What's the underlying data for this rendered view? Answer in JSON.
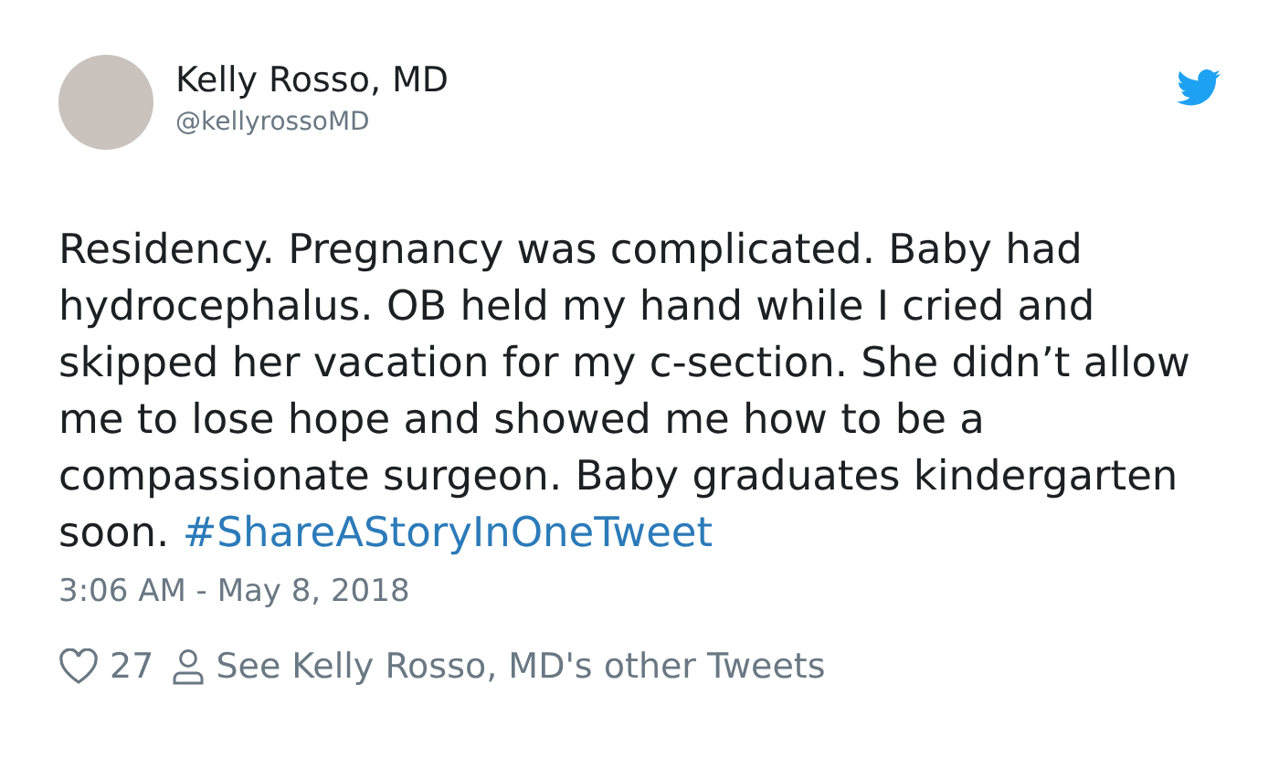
{
  "author": {
    "name": "Kelly Rosso, MD",
    "handle": "@kellyrossoMD"
  },
  "tweet": {
    "text": "Residency. Pregnancy was complicated. Baby had hydrocephalus. OB held my hand while I cried and skipped her vacation for my c-section. She didn’t allow me to lose hope and showed me how to be a compassionate surgeon. Baby graduates kindergarten soon.",
    "hashtag": "#ShareAStoryInOneTweet",
    "timestamp": "3:06 AM - May 8, 2018"
  },
  "footer": {
    "likes": "27",
    "profile_link": "See Kelly Rosso, MD's other Tweets"
  }
}
